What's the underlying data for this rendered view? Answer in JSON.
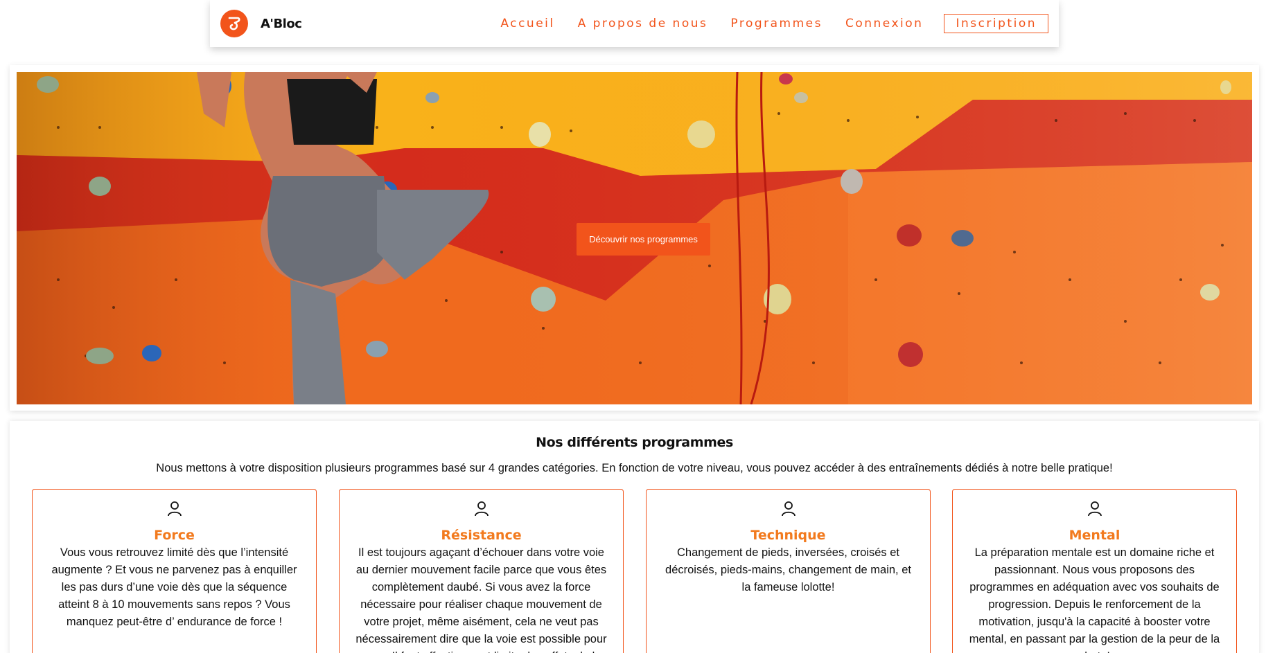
{
  "header": {
    "brand": "A'Bloc",
    "nav": [
      "Accueil",
      "A propos de nous",
      "Programmes",
      "Connexion"
    ],
    "signup_label": "Inscription"
  },
  "hero": {
    "cta_label": "Découvrir nos programmes"
  },
  "programs": {
    "title": "Nos différents programmes",
    "intro": "Nous mettons à votre disposition plusieurs programmes basé sur 4 grandes catégories. En fonction de votre niveau, vous pouvez accéder à des entraînements dédiés à notre belle pratique!",
    "cards": [
      {
        "title": "Force",
        "text": "Vous vous retrouvez limité dès que l’intensité augmente ? Et vous ne parvenez pas à enquiller les pas durs d’une voie dès que la séquence atteint 8 à 10 mouvements sans repos ? Vous manquez peut-être d’ endurance de force !"
      },
      {
        "title": "Résistance",
        "text": "Il est toujours agaçant d’échouer dans votre voie au dernier mouvement facile parce que vous êtes complètement daubé. Si vous avez la force nécessaire pour réaliser chaque mouvement de votre projet, même aisément, cela ne veut pas nécessairement dire que la voie est possible pour vous. Il faut effectivement limiter les effets de la"
      },
      {
        "title": "Technique",
        "text": "Changement de pieds, inversées, croisés et décroisés, pieds-mains, changement de main, et la fameuse lolotte!"
      },
      {
        "title": "Mental",
        "text": "La préparation mentale est un domaine riche et passionnant. Nous vous proposons des programmes en adéquation avec vos souhaits de progression. Depuis le renforcement de la motivation, jusqu'à la capacité à booster votre mental, en passant par la gestion de la peur de la chute!"
      }
    ]
  },
  "colors": {
    "accent": "#f2541b",
    "card_title": "#f27a1e"
  },
  "icons": {
    "logo": "logo-icon",
    "card": "user-icon"
  }
}
